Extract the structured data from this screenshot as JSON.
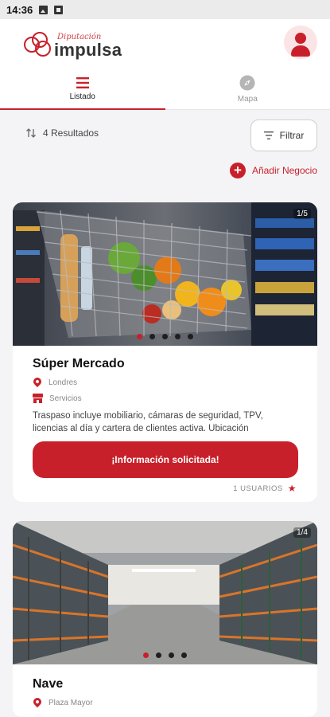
{
  "status_bar": {
    "time": "14:36"
  },
  "header": {
    "logo_top": "Diputación",
    "logo_main": "impulsa"
  },
  "tabs": [
    {
      "label": "Listado",
      "icon": "list-icon",
      "active": true
    },
    {
      "label": "Mapa",
      "icon": "compass-icon",
      "active": false
    }
  ],
  "results": {
    "label": "4 Resultados",
    "filter_label": "Filtrar"
  },
  "add_business": {
    "label": "Añadir Negocio"
  },
  "colors": {
    "accent": "#c8202a",
    "accent_light": "#fbe4e5",
    "background": "#f4f4f6"
  },
  "listings": [
    {
      "image_counter": "1/5",
      "title": "Súper Mercado",
      "location": "Londres",
      "category": "Servicios",
      "description": "Traspaso incluye mobiliario, cámaras de seguridad, TPV, licencias al día y cartera de clientes activa. Ubicación",
      "cta_label": "¡Información solicitada!",
      "users_label": "1 USUARIOS"
    },
    {
      "image_counter": "1/4",
      "title": "Nave",
      "location": "Plaza Mayor"
    }
  ]
}
